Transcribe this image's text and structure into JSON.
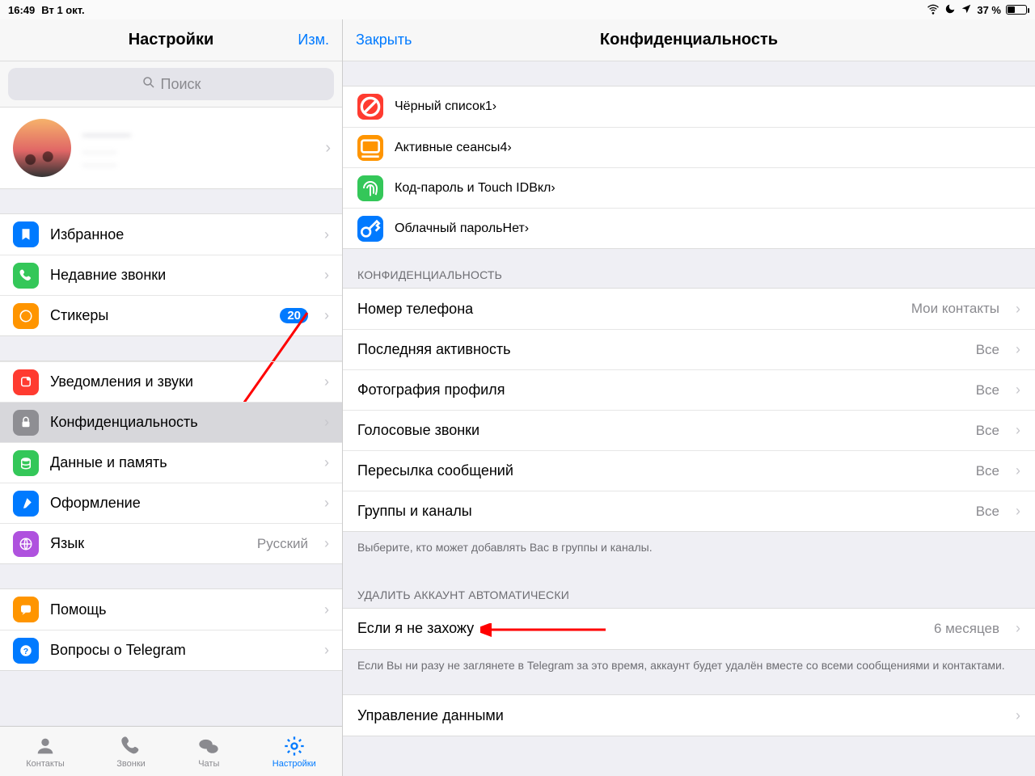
{
  "status": {
    "time": "16:49",
    "date": "Вт 1 окт.",
    "battery_pct": "37 %"
  },
  "sidebar": {
    "title": "Настройки",
    "edit": "Изм.",
    "search_placeholder": "Поиск",
    "profile": {
      "name": "———",
      "phone": "———",
      "username": "———"
    },
    "g1": [
      {
        "icon": "bookmark",
        "color": "#007aff",
        "label": "Избранное"
      },
      {
        "icon": "phone",
        "color": "#34c759",
        "label": "Недавние звонки"
      },
      {
        "icon": "sticker",
        "color": "#ff9500",
        "label": "Стикеры",
        "badge": "20"
      }
    ],
    "g2": [
      {
        "icon": "bell",
        "color": "#ff3b30",
        "label": "Уведомления и звуки"
      },
      {
        "icon": "lock",
        "color": "#8e8e93",
        "label": "Конфиденциальность",
        "selected": true
      },
      {
        "icon": "data",
        "color": "#34c759",
        "label": "Данные и память"
      },
      {
        "icon": "brush",
        "color": "#007aff",
        "label": "Оформление"
      },
      {
        "icon": "globe",
        "color": "#af52de",
        "label": "Язык",
        "value": "Русский"
      }
    ],
    "g3": [
      {
        "icon": "chat",
        "color": "#ff9500",
        "label": "Помощь"
      },
      {
        "icon": "question",
        "color": "#007aff",
        "label": "Вопросы о Telegram"
      }
    ],
    "tabs": [
      {
        "label": "Контакты"
      },
      {
        "label": "Звонки"
      },
      {
        "label": "Чаты"
      },
      {
        "label": "Настройки",
        "active": true
      }
    ]
  },
  "detail": {
    "close": "Закрыть",
    "title": "Конфиденциальность",
    "security": [
      {
        "icon": "block",
        "color": "#ff3b30",
        "label": "Чёрный список",
        "value": "1"
      },
      {
        "icon": "monitor",
        "color": "#ff9500",
        "label": "Активные сеансы",
        "value": "4"
      },
      {
        "icon": "fingerprint",
        "color": "#34c759",
        "label": "Код-пароль и Touch ID",
        "value": "Вкл"
      },
      {
        "icon": "key",
        "color": "#007aff",
        "label": "Облачный пароль",
        "value": "Нет"
      }
    ],
    "privacy_header": "КОНФИДЕНЦИАЛЬНОСТЬ",
    "privacy": [
      {
        "label": "Номер телефона",
        "value": "Мои контакты"
      },
      {
        "label": "Последняя активность",
        "value": "Все"
      },
      {
        "label": "Фотография профиля",
        "value": "Все"
      },
      {
        "label": "Голосовые звонки",
        "value": "Все"
      },
      {
        "label": "Пересылка сообщений",
        "value": "Все"
      },
      {
        "label": "Группы и каналы",
        "value": "Все"
      }
    ],
    "privacy_footer": "Выберите, кто может добавлять Вас в группы и каналы.",
    "delete_header": "УДАЛИТЬ АККАУНТ АВТОМАТИЧЕСКИ",
    "delete": {
      "label": "Если я не захожу",
      "value": "6 месяцев"
    },
    "delete_footer": "Если Вы ни разу не заглянете в Telegram за это время, аккаунт будет удалён вместе со всеми сообщениями и контактами.",
    "manage": {
      "label": "Управление данными"
    }
  }
}
